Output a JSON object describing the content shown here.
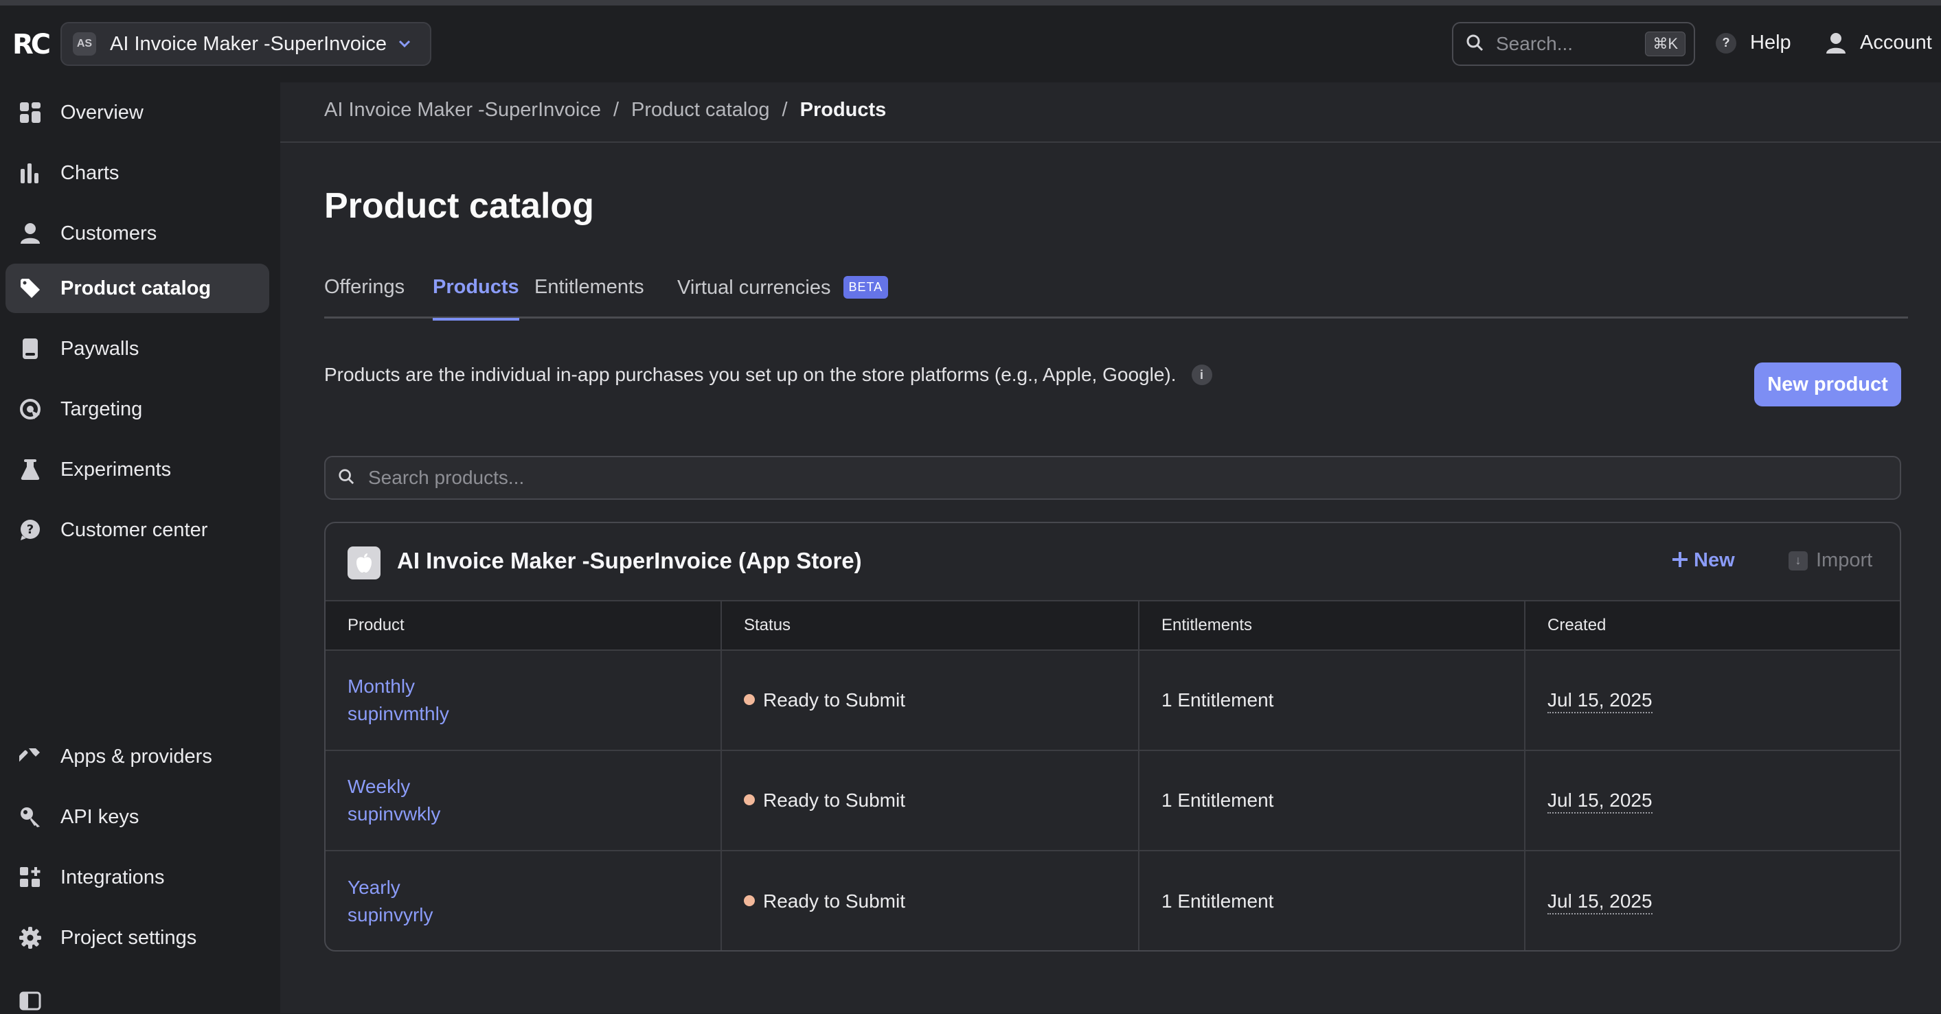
{
  "app": {
    "logo_text": "RC",
    "project_badge": "AS",
    "project_name": "AI Invoice Maker -SuperInvoice"
  },
  "topbar": {
    "search_placeholder": "Search...",
    "search_shortcut": "⌘K",
    "help_label": "Help",
    "account_label": "Account"
  },
  "sidebar": {
    "items": [
      {
        "label": "Overview",
        "icon": "overview-icon"
      },
      {
        "label": "Charts",
        "icon": "charts-icon"
      },
      {
        "label": "Customers",
        "icon": "customers-icon"
      },
      {
        "label": "Product catalog",
        "icon": "tag-icon",
        "active": true
      },
      {
        "label": "Paywalls",
        "icon": "paywall-icon"
      },
      {
        "label": "Targeting",
        "icon": "targeting-icon"
      },
      {
        "label": "Experiments",
        "icon": "flask-icon"
      },
      {
        "label": "Customer center",
        "icon": "help-bubble-icon"
      }
    ],
    "bottom_items": [
      {
        "label": "Apps & providers",
        "icon": "hammer-icon"
      },
      {
        "label": "API keys",
        "icon": "key-icon"
      },
      {
        "label": "Integrations",
        "icon": "integrations-icon"
      },
      {
        "label": "Project settings",
        "icon": "gear-icon"
      }
    ]
  },
  "breadcrumb": {
    "items": [
      "AI Invoice Maker -SuperInvoice",
      "Product catalog",
      "Products"
    ],
    "separator": "/"
  },
  "page": {
    "title": "Product catalog",
    "tabs": [
      {
        "label": "Offerings"
      },
      {
        "label": "Products",
        "active": true
      },
      {
        "label": "Entitlements"
      },
      {
        "label": "Virtual currencies",
        "badge": "BETA"
      }
    ],
    "description": "Products are the individual in-app purchases you set up on the store platforms (e.g., Apple, Google).",
    "new_product_label": "New product",
    "search_placeholder": "Search products..."
  },
  "store_card": {
    "title": "AI Invoice Maker -SuperInvoice (App Store)",
    "new_label": "New",
    "import_label": "Import",
    "columns": [
      "Product",
      "Status",
      "Entitlements",
      "Created"
    ],
    "rows": [
      {
        "name": "Monthly",
        "identifier": "supinvmthly",
        "status": "Ready to Submit",
        "entitlements": "1 Entitlement",
        "created": "Jul 15, 2025"
      },
      {
        "name": "Weekly",
        "identifier": "supinvwkly",
        "status": "Ready to Submit",
        "entitlements": "1 Entitlement",
        "created": "Jul 15, 2025"
      },
      {
        "name": "Yearly",
        "identifier": "supinvyrly",
        "status": "Ready to Submit",
        "entitlements": "1 Entitlement",
        "created": "Jul 15, 2025"
      }
    ]
  },
  "colors": {
    "accent": "#7d8ef4",
    "link": "#8b9cf9",
    "status_dot": "#f2b89a",
    "background": "#25262a",
    "sidebar": "#1e1f22"
  }
}
